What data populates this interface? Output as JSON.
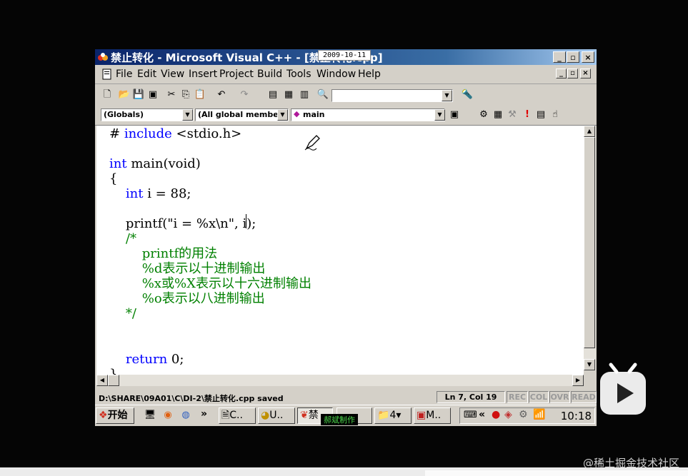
{
  "window": {
    "title": "禁止转化 - Microsoft Visual C++ - [禁止转化.cpp]",
    "date_tag": "2009-10-11",
    "minimize": "_",
    "maximize": "▫",
    "close": "×"
  },
  "menu": [
    "File",
    "Edit",
    "View",
    "Insert",
    "Project",
    "Build",
    "Tools",
    "Window",
    "Help"
  ],
  "toolbar": {
    "find_value": "",
    "globals_combo": "(Globals)",
    "members_combo": "(All global member",
    "function_combo": "main"
  },
  "code_lines": [
    {
      "pre": "# ",
      "kw": "include",
      "post": " <stdio.h>"
    },
    {
      "pre": "",
      "kw": "",
      "post": ""
    },
    {
      "pre": "",
      "kw": "int",
      "post": " main(void)"
    },
    {
      "pre": "{",
      "kw": "",
      "post": ""
    },
    {
      "pre": "    ",
      "kw": "int",
      "post": " i = 88;"
    },
    {
      "pre": "",
      "kw": "",
      "post": ""
    },
    {
      "pre": "    printf(\"i = %x\\n\", i);",
      "kw": "",
      "post": ""
    },
    {
      "pre": "    /*",
      "kw": "",
      "post": "",
      "comment": true
    },
    {
      "pre": "        printf的用法",
      "kw": "",
      "post": "",
      "comment": true
    },
    {
      "pre": "        %d表示以十进制输出",
      "kw": "",
      "post": "",
      "comment": true
    },
    {
      "pre": "        %x或%X表示以十六进制输出",
      "kw": "",
      "post": "",
      "comment": true
    },
    {
      "pre": "        %o表示以八进制输出",
      "kw": "",
      "post": "",
      "comment": true
    },
    {
      "pre": "    */",
      "kw": "",
      "post": "",
      "comment": true
    },
    {
      "pre": "",
      "kw": "",
      "post": ""
    },
    {
      "pre": "",
      "kw": "",
      "post": ""
    },
    {
      "pre": "    ",
      "kw": "return",
      "post": " 0;"
    },
    {
      "pre": "}",
      "kw": "",
      "post": ""
    }
  ],
  "status": {
    "message": "D:\\SHARE\\09A01\\C\\DI-2\\禁止转化.cpp saved",
    "position": "Ln 7, Col 19",
    "rec": "REC",
    "col": "COL",
    "ovr": "OVR",
    "read": "READ"
  },
  "taskbar": {
    "start": "开始",
    "more": "»",
    "tasks": [
      "C..",
      "U..",
      "禁",
      "4▾",
      "M.."
    ],
    "tray_more": "«",
    "clock": "10:18",
    "overlay_label": "郝斌制作"
  },
  "watermark": "@稀土掘金技术社区",
  "colors": {
    "keyword": "#0000ff",
    "comment": "#008000",
    "titlebar": "#0a246a"
  }
}
